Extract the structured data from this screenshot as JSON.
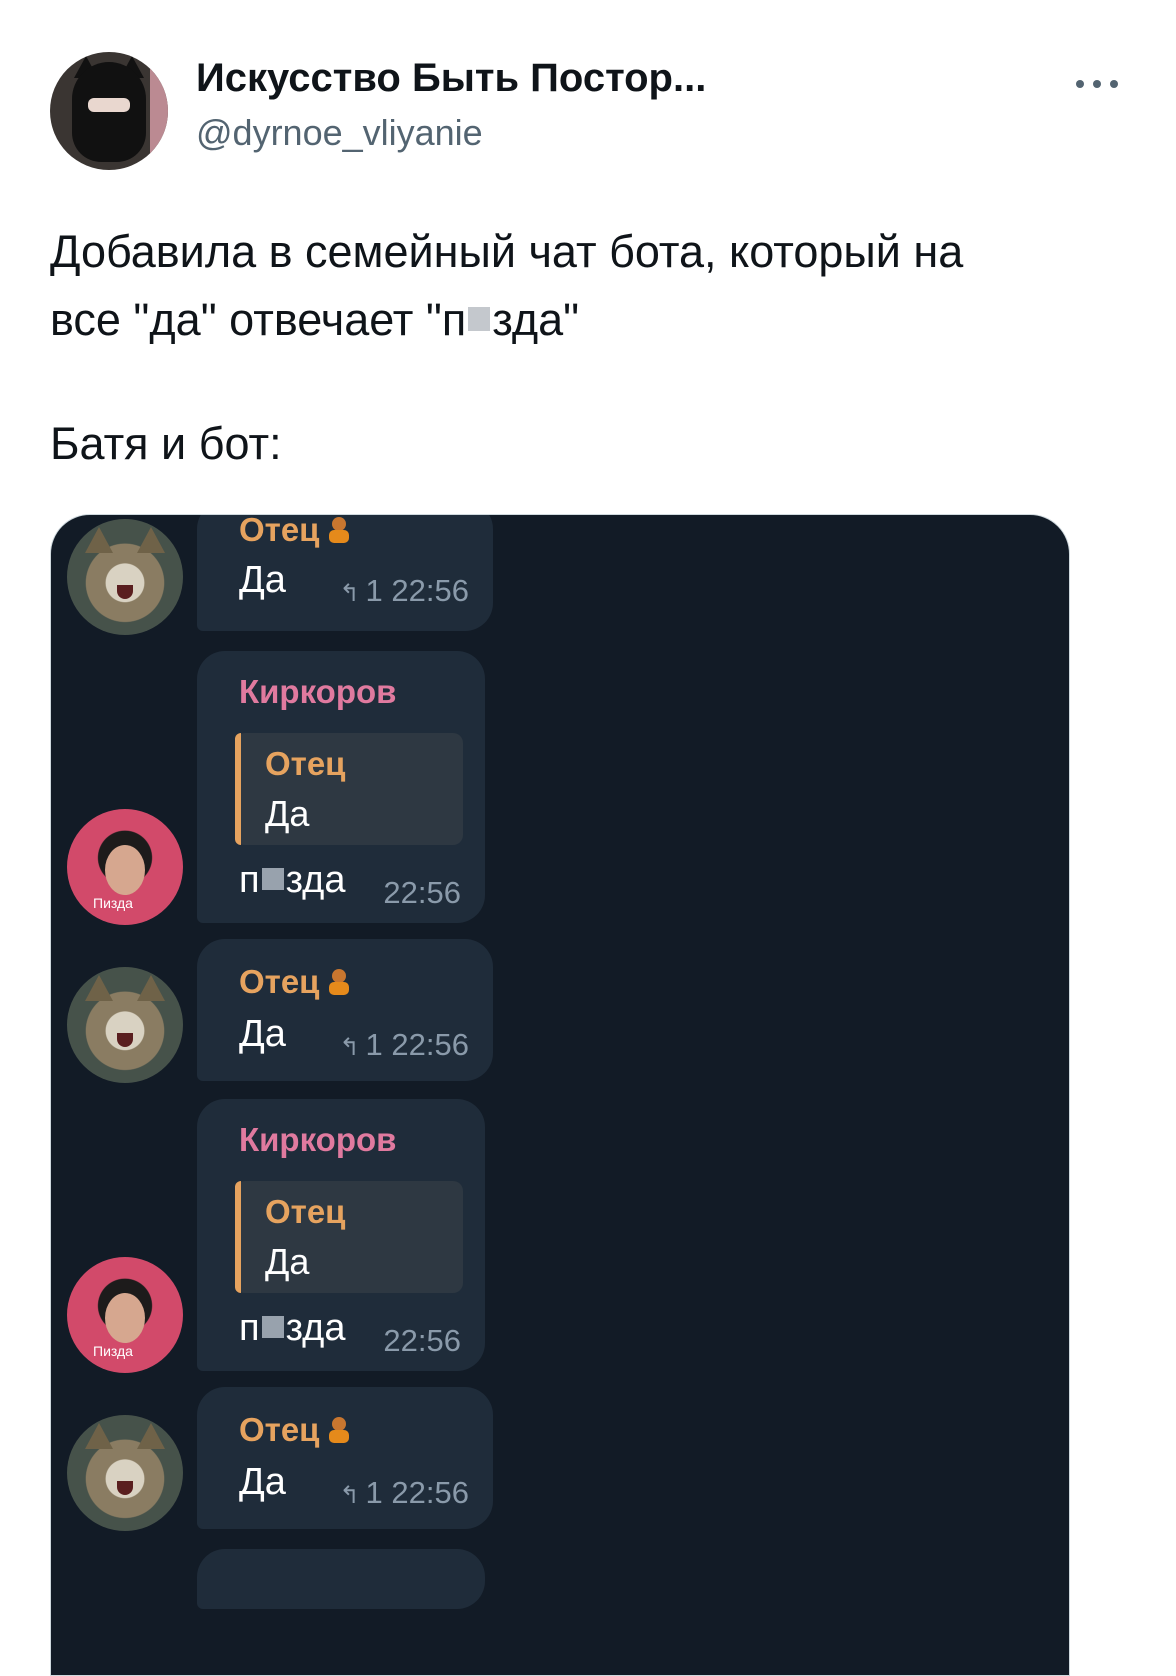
{
  "tweet": {
    "author_name": "Искусство Быть Постор...",
    "handle": "@dyrnoe_vliyanie",
    "text_line1": "Добавила в семейный чат бота, который на",
    "text_line2a": "все \"да\" отвечает \"п",
    "text_line2b": "зда\"",
    "text_line3": "Батя и бот:"
  },
  "chat": {
    "messages": [
      {
        "sender": "Отец",
        "text": "Да",
        "replies": "1",
        "time": "22:56"
      },
      {
        "sender": "Киркоров",
        "quote_sender": "Отец",
        "quote_text": "Да",
        "text_a": "п",
        "text_b": "зда",
        "time": "22:56",
        "avatar_caption": "Пизда"
      },
      {
        "sender": "Отец",
        "text": "Да",
        "replies": "1",
        "time": "22:56"
      },
      {
        "sender": "Киркоров",
        "quote_sender": "Отец",
        "quote_text": "Да",
        "text_a": "п",
        "text_b": "зда",
        "time": "22:56",
        "avatar_caption": "Пизда"
      },
      {
        "sender": "Отец",
        "text": "Да",
        "replies": "1",
        "time": "22:56"
      }
    ]
  },
  "colors": {
    "otec": "#e6a35f",
    "kirkorov": "#e07a9f",
    "chat_bg": "#121b26",
    "bubble": "#1f2c3a"
  }
}
